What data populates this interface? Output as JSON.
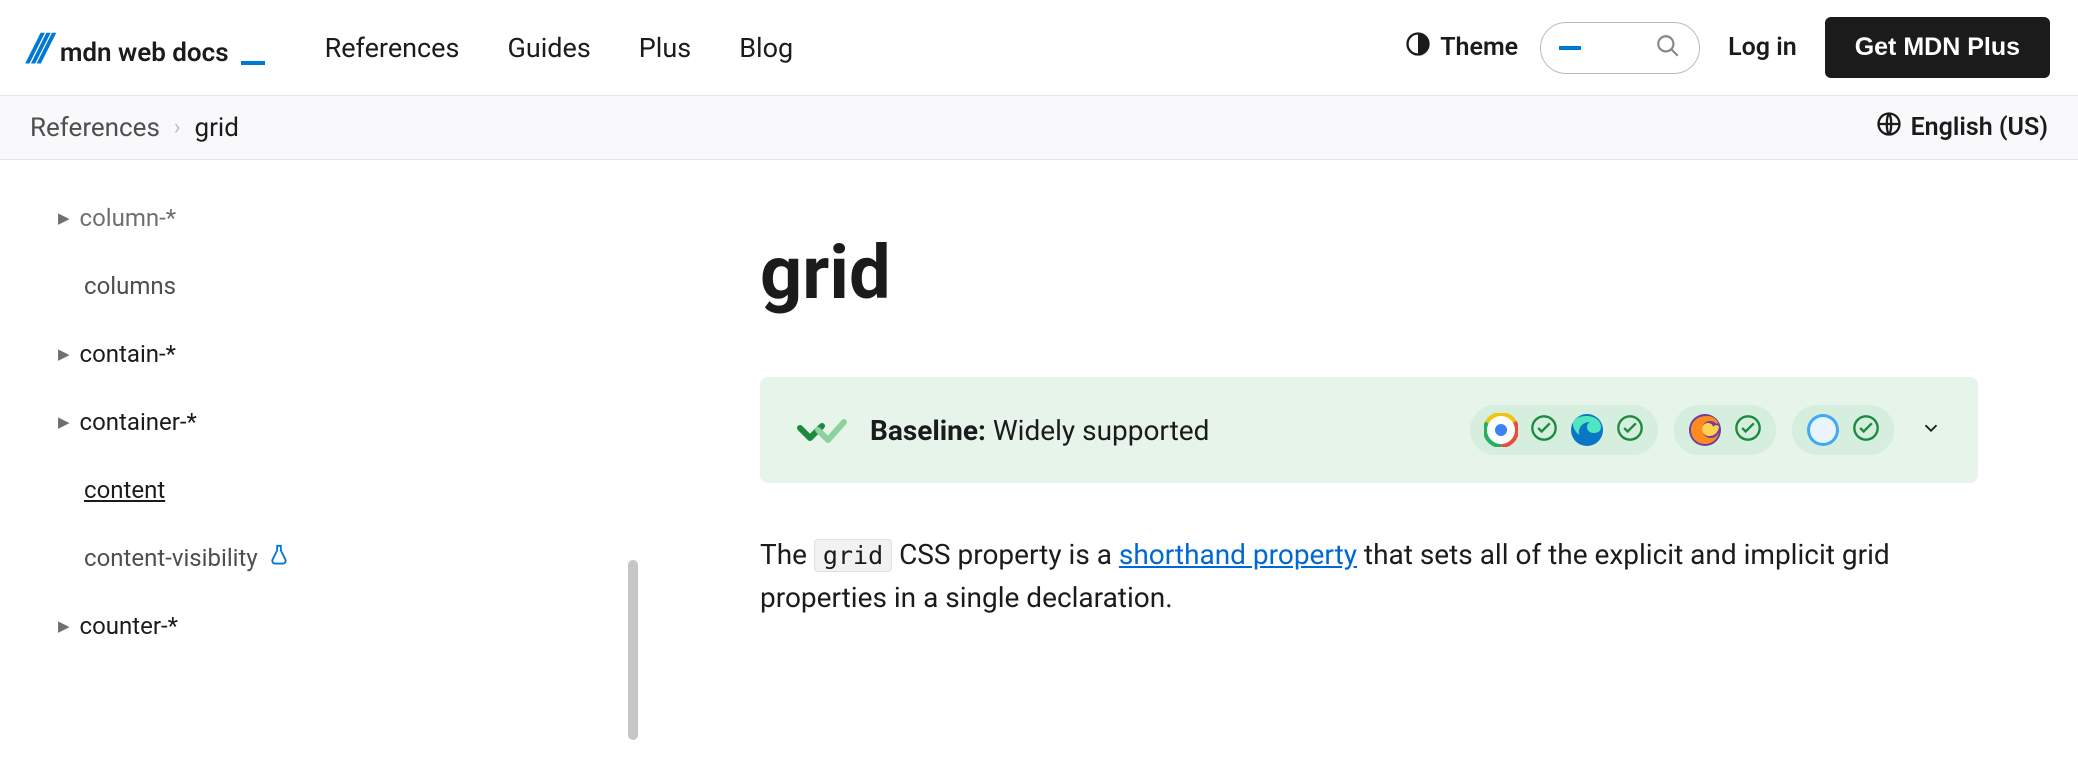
{
  "logo": {
    "text": "mdn web docs"
  },
  "nav": {
    "references": "References",
    "guides": "Guides",
    "plus": "Plus",
    "blog": "Blog"
  },
  "theme_label": "Theme",
  "login_label": "Log in",
  "getplus_label": "Get MDN Plus",
  "breadcrumb": {
    "root": "References",
    "current": "grid"
  },
  "language": "English (US)",
  "sidebar": {
    "items": [
      {
        "label": "column-*",
        "expandable": true,
        "sub": true
      },
      {
        "label": "columns",
        "expandable": false
      },
      {
        "label": "contain-*",
        "expandable": true
      },
      {
        "label": "container-*",
        "expandable": true
      },
      {
        "label": "content",
        "expandable": false,
        "underlined": true
      },
      {
        "label": "content-visibility",
        "expandable": false,
        "experimental": true
      },
      {
        "label": "counter-*",
        "expandable": true
      }
    ]
  },
  "page": {
    "title": "grid",
    "baseline_strong": "Baseline:",
    "baseline_rest": " Widely supported",
    "browsers": [
      "chrome",
      "edge",
      "firefox",
      "safari"
    ],
    "intro_pre": "The ",
    "intro_code": "grid",
    "intro_mid": " CSS property is a ",
    "intro_link": "shorthand property",
    "intro_post": " that sets all of the explicit and implicit grid properties in a single declaration."
  }
}
